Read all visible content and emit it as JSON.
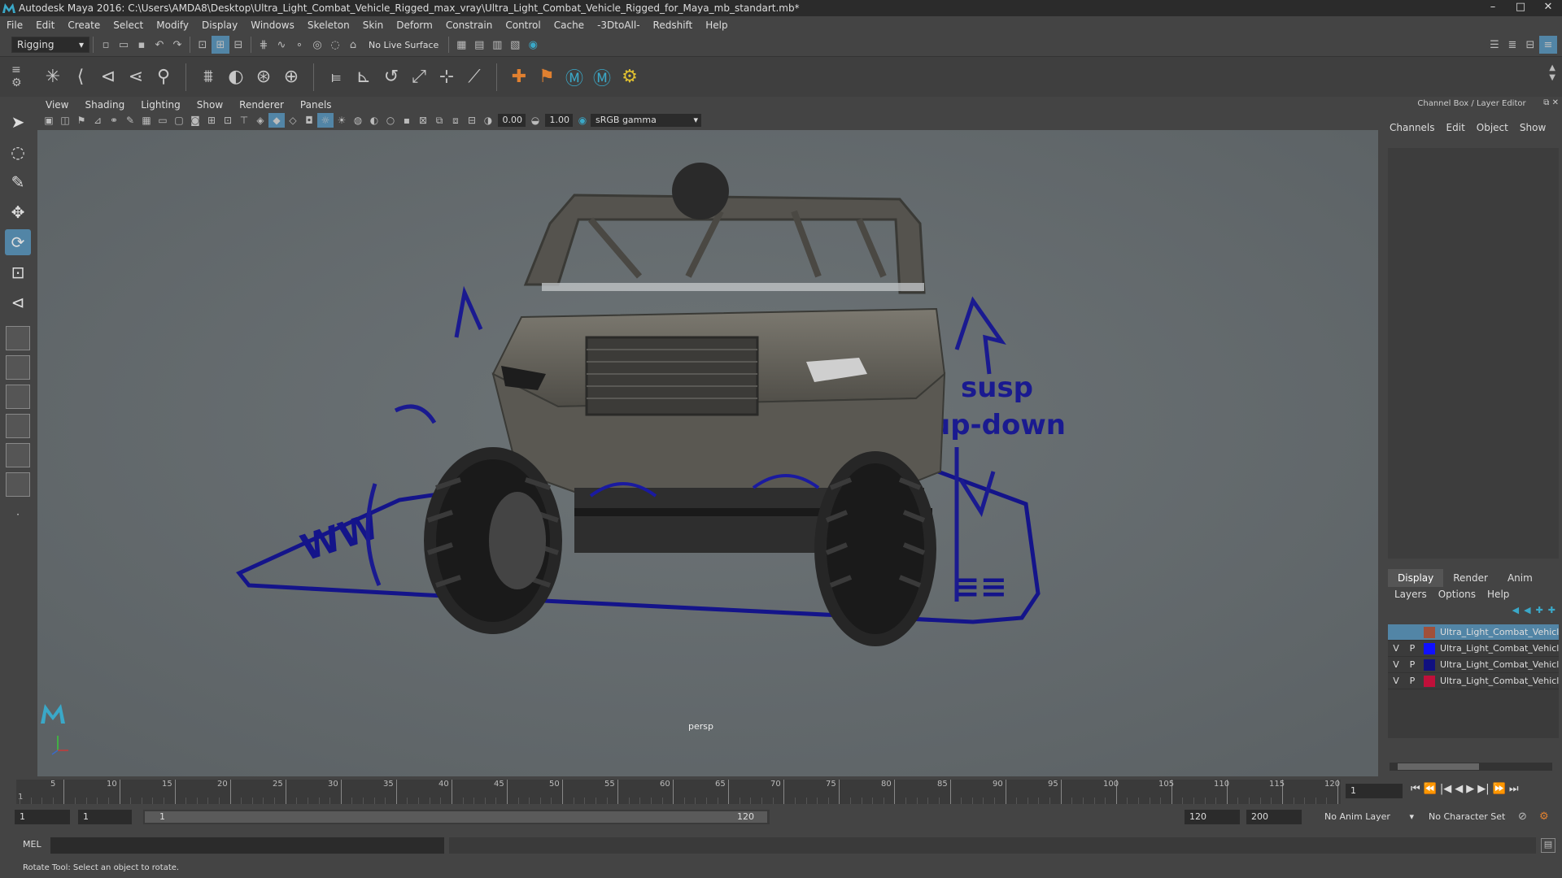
{
  "window": {
    "title": "Autodesk Maya 2016: C:\\Users\\AMDA8\\Desktop\\Ultra_Light_Combat_Vehicle_Rigged_max_vray\\Ultra_Light_Combat_Vehicle_Rigged_for_Maya_mb_standart.mb*",
    "controls": [
      "–",
      "□",
      "✕"
    ]
  },
  "menubar": [
    "File",
    "Edit",
    "Create",
    "Select",
    "Modify",
    "Display",
    "Windows",
    "Skeleton",
    "Skin",
    "Deform",
    "Constrain",
    "Control",
    "Cache",
    "-3DtoAll-",
    "Redshift",
    "Help"
  ],
  "toolbar": {
    "mode": "Rigging",
    "live_surface": "No Live Surface"
  },
  "panel": {
    "menus": [
      "View",
      "Shading",
      "Lighting",
      "Show",
      "Renderer",
      "Panels"
    ],
    "exposure": "0.00",
    "gamma": "1.00",
    "color_space": "sRGB gamma",
    "camera": "persp"
  },
  "viewport_labels": {
    "susp": "susp",
    "updown": "up-down"
  },
  "right_panel": {
    "title": "Channel Box / Layer Editor",
    "menus": [
      "Channels",
      "Edit",
      "Object",
      "Show"
    ],
    "tabs": [
      "Display",
      "Render",
      "Anim"
    ],
    "active_tab": "Display",
    "submenus": [
      "Layers",
      "Options",
      "Help"
    ],
    "layers": [
      {
        "v": "",
        "p": "",
        "name": "Ultra_Light_Combat_Vehicle",
        "color": "#a0503a",
        "selected": true
      },
      {
        "v": "V",
        "p": "P",
        "name": "Ultra_Light_Combat_Vehicle",
        "color": "#1010ff",
        "selected": false
      },
      {
        "v": "V",
        "p": "P",
        "name": "Ultra_Light_Combat_Vehicle",
        "color": "#101080",
        "selected": false
      },
      {
        "v": "V",
        "p": "P",
        "name": "Ultra_Light_Combat_Vehicle",
        "color": "#c0103a",
        "selected": false
      }
    ]
  },
  "timeline": {
    "ticks": [
      "5",
      "10",
      "15",
      "20",
      "25",
      "30",
      "35",
      "40",
      "45",
      "50",
      "55",
      "60",
      "65",
      "70",
      "75",
      "80",
      "85",
      "90",
      "95",
      "100",
      "105",
      "110",
      "115",
      "120"
    ],
    "start_label": "1",
    "current_frame": "1",
    "controls": [
      "⏮",
      "⏪",
      "|◀",
      "◀",
      "▶",
      "▶|",
      "⏩",
      "⏭"
    ]
  },
  "range": {
    "start": "1",
    "inner_start": "1",
    "slider_start": "1",
    "slider_end": "120",
    "end": "120",
    "max": "200",
    "anim_layer": "No Anim Layer",
    "char_set": "No Character Set"
  },
  "cmdline": {
    "label": "MEL"
  },
  "helpline": {
    "text": "Rotate Tool: Select an object to rotate."
  }
}
